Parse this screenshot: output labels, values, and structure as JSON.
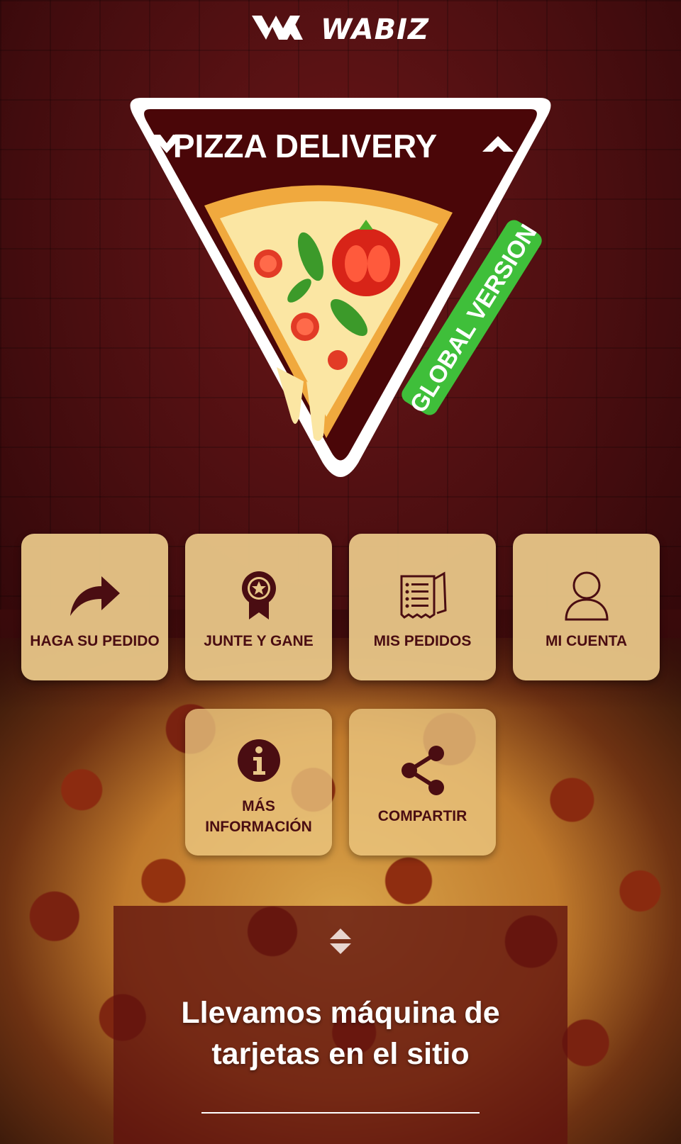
{
  "brand": {
    "name": "WABIZ"
  },
  "emblem": {
    "title": "PIZZA DELIVERY",
    "badge": "GLOBAL VERSION",
    "badge_color": "#3fbf3a"
  },
  "menu": [
    {
      "label": "HAGA SU PEDIDO",
      "icon": "share-arrow-icon"
    },
    {
      "label": "JUNTE Y GANE",
      "icon": "award-badge-icon"
    },
    {
      "label": "MIS PEDIDOS",
      "icon": "receipt-list-icon"
    },
    {
      "label": "MI CUENTA",
      "icon": "user-icon"
    },
    {
      "label": "MÁS\nINFORMACIÓN",
      "icon": "info-icon"
    },
    {
      "label": "COMPARTIR",
      "icon": "share-icon"
    }
  ],
  "promo": {
    "line1": "Llevamos máquina de",
    "line2": "tarjetas en el sitio"
  },
  "colors": {
    "background": "#4a0e10",
    "tile": "#e8c688",
    "tile_text": "#4a0d12"
  }
}
